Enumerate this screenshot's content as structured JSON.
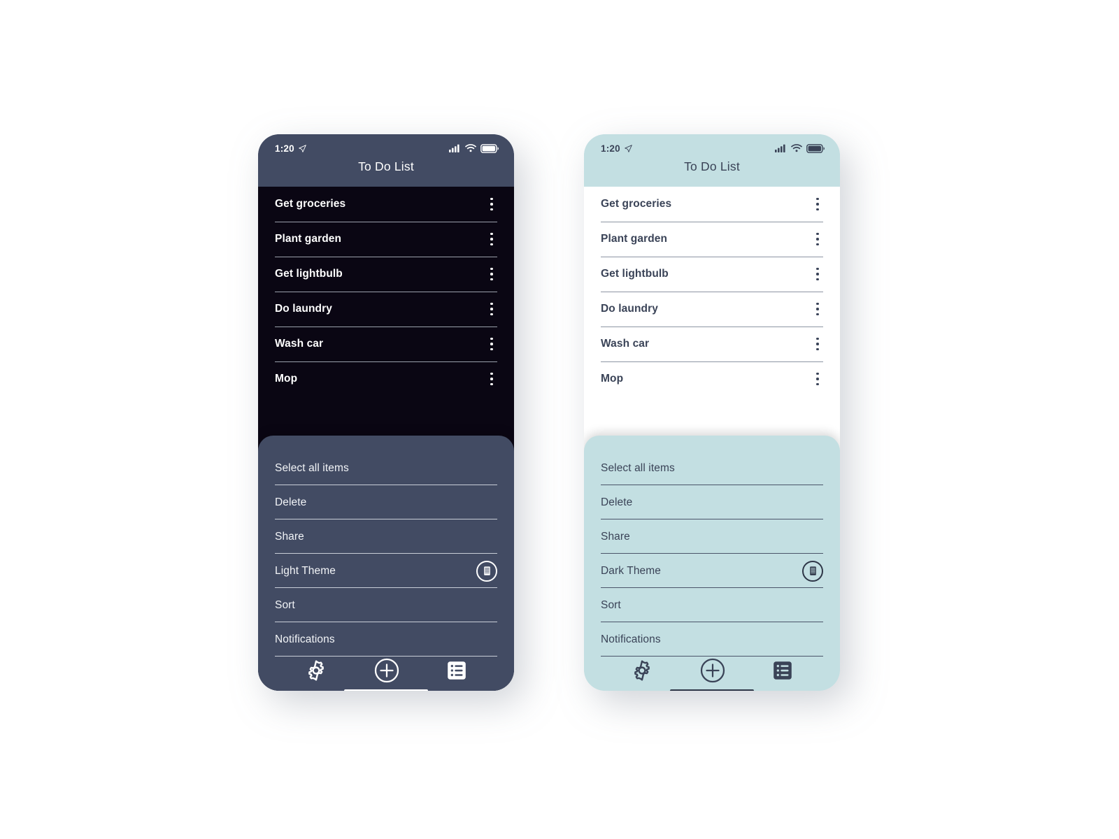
{
  "page": {
    "background_color": "#ffffff"
  },
  "phones": [
    {
      "id": "dark",
      "theme_name": "dark",
      "accent_color": "#424b63",
      "list_background": "#0a0613",
      "text_color": "#ffffff",
      "status": {
        "time": "1:20",
        "location_icon": "location-arrow-icon",
        "signal_icon": "cellular-signal-icon",
        "wifi_icon": "wifi-icon",
        "battery_icon": "battery-icon"
      },
      "title": "To Do List",
      "tasks": [
        {
          "label": "Get groceries",
          "menu_icon": "kebab-menu-icon"
        },
        {
          "label": "Plant garden",
          "menu_icon": "kebab-menu-icon"
        },
        {
          "label": "Get lightbulb",
          "menu_icon": "kebab-menu-icon"
        },
        {
          "label": "Do laundry",
          "menu_icon": "kebab-menu-icon"
        },
        {
          "label": "Wash car",
          "menu_icon": "kebab-menu-icon"
        },
        {
          "label": "Mop",
          "menu_icon": "kebab-menu-icon"
        }
      ],
      "menu": {
        "items": [
          {
            "label": "Select all items",
            "toggle": false
          },
          {
            "label": "Delete",
            "toggle": false
          },
          {
            "label": "Share",
            "toggle": false
          },
          {
            "label": "Light Theme",
            "toggle": true,
            "toggle_icon": "theme-switch-icon"
          },
          {
            "label": "Sort",
            "toggle": false
          },
          {
            "label": "Notifications",
            "toggle": false
          }
        ]
      },
      "nav": [
        {
          "name": "settings",
          "icon": "gear-icon"
        },
        {
          "name": "add",
          "icon": "plus-circle-icon"
        },
        {
          "name": "list",
          "icon": "list-icon"
        }
      ]
    },
    {
      "id": "light",
      "theme_name": "light",
      "accent_color": "#c3dfe2",
      "list_background": "#ffffff",
      "text_color": "#3a4357",
      "status": {
        "time": "1:20",
        "location_icon": "location-arrow-icon",
        "signal_icon": "cellular-signal-icon",
        "wifi_icon": "wifi-icon",
        "battery_icon": "battery-icon"
      },
      "title": "To Do List",
      "tasks": [
        {
          "label": "Get groceries",
          "menu_icon": "kebab-menu-icon"
        },
        {
          "label": "Plant garden",
          "menu_icon": "kebab-menu-icon"
        },
        {
          "label": "Get lightbulb",
          "menu_icon": "kebab-menu-icon"
        },
        {
          "label": "Do laundry",
          "menu_icon": "kebab-menu-icon"
        },
        {
          "label": "Wash car",
          "menu_icon": "kebab-menu-icon"
        },
        {
          "label": "Mop",
          "menu_icon": "kebab-menu-icon"
        }
      ],
      "menu": {
        "items": [
          {
            "label": "Select all items",
            "toggle": false
          },
          {
            "label": "Delete",
            "toggle": false
          },
          {
            "label": "Share",
            "toggle": false
          },
          {
            "label": "Dark Theme",
            "toggle": true,
            "toggle_icon": "theme-switch-icon"
          },
          {
            "label": "Sort",
            "toggle": false
          },
          {
            "label": "Notifications",
            "toggle": false
          }
        ]
      },
      "nav": [
        {
          "name": "settings",
          "icon": "gear-icon"
        },
        {
          "name": "add",
          "icon": "plus-circle-icon"
        },
        {
          "name": "list",
          "icon": "list-icon"
        }
      ]
    }
  ]
}
